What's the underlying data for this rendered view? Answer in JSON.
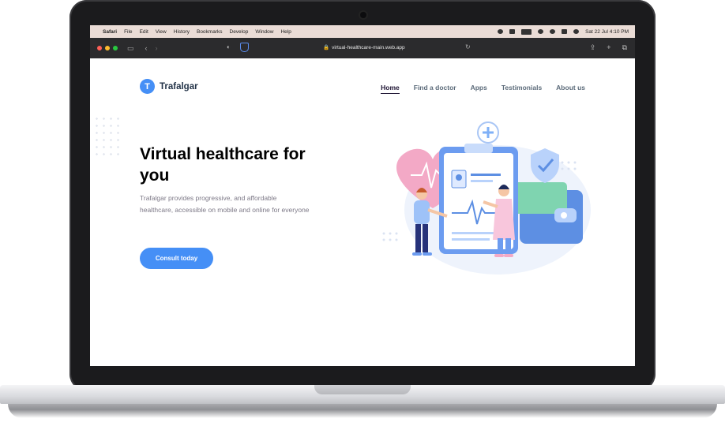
{
  "menubar": {
    "app": "Safari",
    "items": [
      "File",
      "Edit",
      "View",
      "History",
      "Bookmarks",
      "Develop",
      "Window",
      "Help"
    ],
    "clock": "Sat 22 Jul  4:10 PM"
  },
  "browser": {
    "url": "virtual-healthcare-main.web.app"
  },
  "site": {
    "logo_letter": "T",
    "brand": "Trafalgar",
    "nav": [
      "Home",
      "Find a doctor",
      "Apps",
      "Testimonials",
      "About us"
    ],
    "hero_title": "Virtual healthcare for you",
    "hero_desc": "Trafalgar provides progressive, and affordable healthcare, accessible on mobile and online for everyone",
    "cta": "Consult today"
  },
  "colors": {
    "primary": "#458ff6",
    "heading": "#000000",
    "muted": "#7d7987"
  }
}
